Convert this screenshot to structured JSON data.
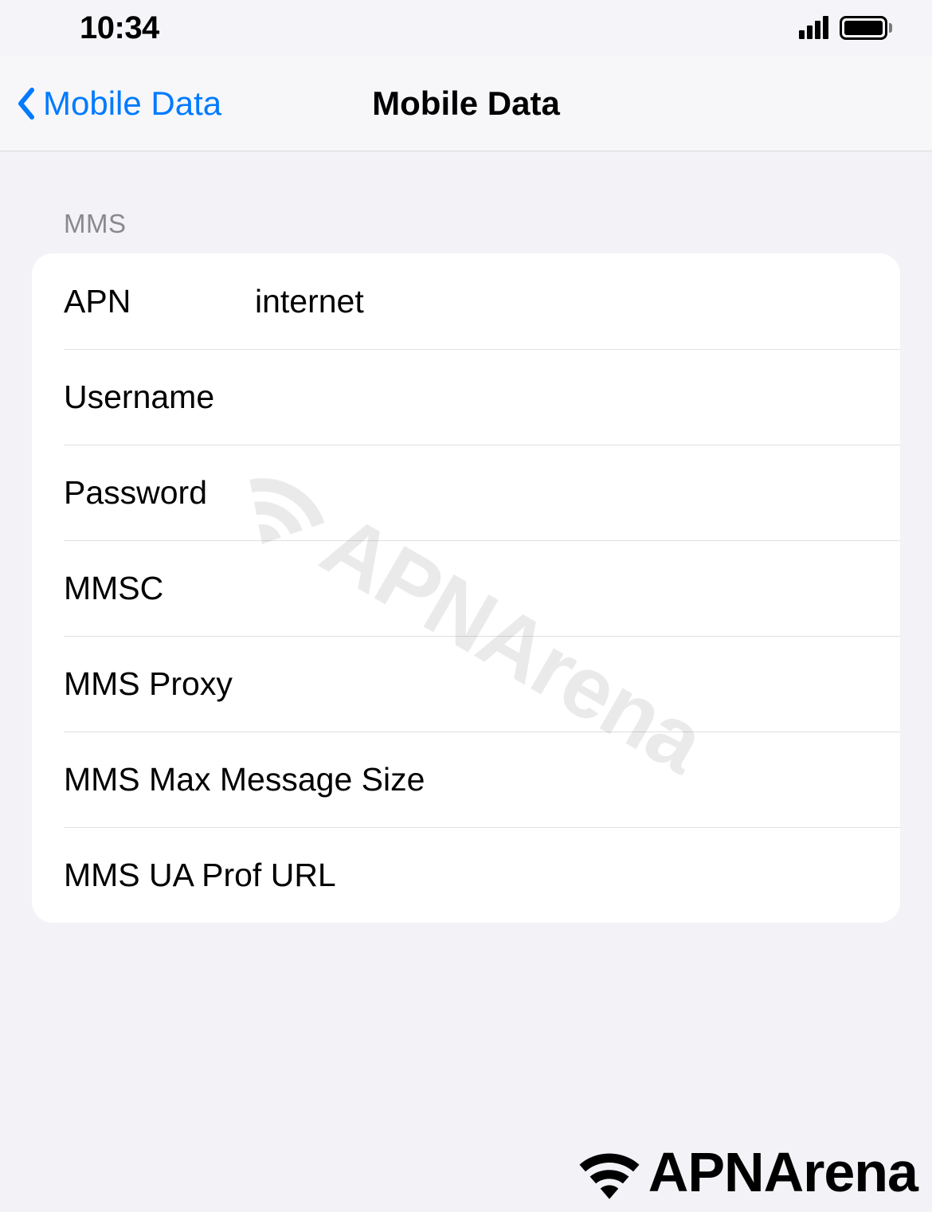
{
  "status": {
    "time": "10:34"
  },
  "nav": {
    "back_label": "Mobile Data",
    "title": "Mobile Data"
  },
  "section": {
    "header": "MMS"
  },
  "fields": {
    "apn": {
      "label": "APN",
      "value": "internet"
    },
    "username": {
      "label": "Username",
      "value": ""
    },
    "password": {
      "label": "Password",
      "value": ""
    },
    "mmsc": {
      "label": "MMSC",
      "value": ""
    },
    "mms_proxy": {
      "label": "MMS Proxy",
      "value": ""
    },
    "mms_max": {
      "label": "MMS Max Message Size",
      "value": ""
    },
    "mms_ua": {
      "label": "MMS UA Prof URL",
      "value": ""
    }
  },
  "watermark": {
    "text": "APNArena"
  },
  "brand": {
    "text": "APNArena"
  }
}
